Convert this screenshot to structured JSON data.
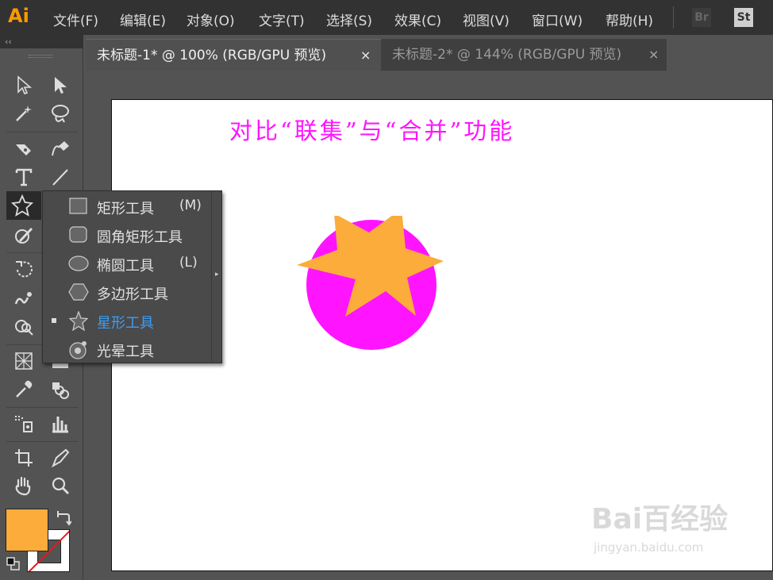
{
  "app": {
    "logo": "Ai"
  },
  "menu": [
    "文件(F)",
    "编辑(E)",
    "对象(O)",
    "文字(T)",
    "选择(S)",
    "效果(C)",
    "视图(V)",
    "窗口(W)",
    "帮助(H)"
  ],
  "apps": {
    "bridge": "Br",
    "stock": "St"
  },
  "tabs": [
    {
      "label": "未标题-1* @ 100% (RGB/GPU 预览)",
      "active": true
    },
    {
      "label": "未标题-2* @ 144% (RGB/GPU 预览)",
      "active": false
    }
  ],
  "tab_close_glyph": "×",
  "toolbar": {
    "collapse": "‹‹"
  },
  "artboard": {
    "title": "对比“联集”与“合并”功能"
  },
  "shapes": {
    "circle_color": "#ff14ff",
    "star_color": "#fbac3b"
  },
  "flyout": {
    "items": [
      {
        "label": "矩形工具",
        "shortcut": "(M)",
        "icon": "rectangle-icon"
      },
      {
        "label": "圆角矩形工具",
        "shortcut": "",
        "icon": "rounded-rectangle-icon"
      },
      {
        "label": "椭圆工具",
        "shortcut": "(L)",
        "icon": "ellipse-icon"
      },
      {
        "label": "多边形工具",
        "shortcut": "",
        "icon": "polygon-icon"
      },
      {
        "label": "星形工具",
        "shortcut": "",
        "icon": "star-icon",
        "selected": true
      },
      {
        "label": "光晕工具",
        "shortcut": "",
        "icon": "flare-icon"
      }
    ],
    "selected_color": "#3d9df2"
  },
  "swatches": {
    "fill": "#fbac3b",
    "stroke": "none"
  },
  "watermark": {
    "main": "Bai百经验",
    "sub": "jingyan.baidu.com"
  }
}
